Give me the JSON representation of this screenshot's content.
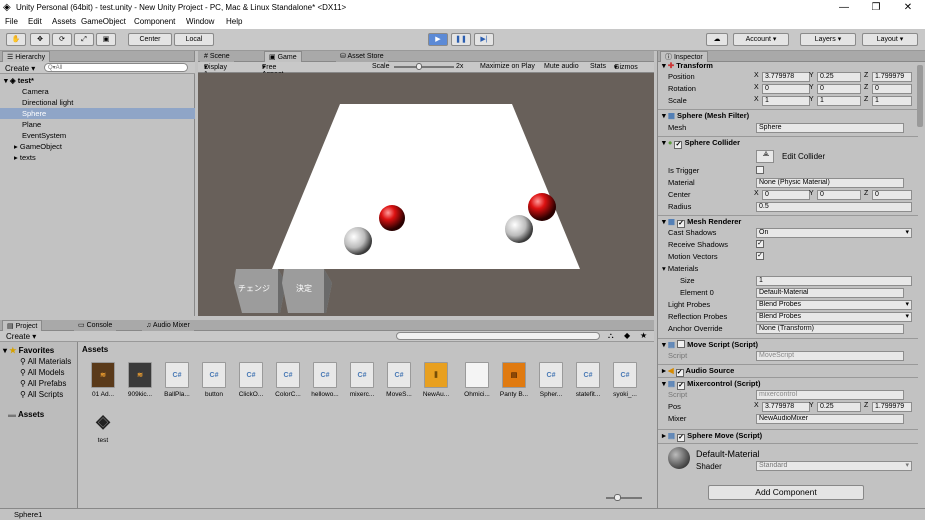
{
  "window": {
    "title": "Unity Personal (64bit) - test.unity - New Unity Project - PC, Mac & Linux Standalone* <DX11>",
    "minimize": "—",
    "maximize": "❐",
    "close": "✕"
  },
  "menu": [
    "File",
    "Edit",
    "Assets",
    "GameObject",
    "Component",
    "Window",
    "Help"
  ],
  "toolbar": {
    "center": "Center",
    "local": "Local",
    "account": "Account",
    "layers": "Layers",
    "layout": "Layout"
  },
  "hierarchy": {
    "tab": "Hierarchy",
    "create": "Create",
    "search_placeholder": "Q▾All",
    "scene": "test*",
    "items": [
      "Camera",
      "Directional light",
      "Sphere",
      "Plane",
      "EventSystem",
      "GameObject",
      "texts"
    ]
  },
  "game": {
    "tabs": [
      "Scene",
      "Game",
      "Asset Store"
    ],
    "display": "Display 1",
    "aspect": "Free Aspect",
    "scale_label": "Scale",
    "scale_value": "2x",
    "options": [
      "Maximize on Play",
      "Mute audio",
      "Stats",
      "Gizmos"
    ],
    "buttons": [
      "チェンジ",
      "決定"
    ]
  },
  "project": {
    "tabs": [
      "Project",
      "Console",
      "Audio Mixer"
    ],
    "create": "Create",
    "favorites": "Favorites",
    "fav_items": [
      "All Materials",
      "All Models",
      "All Prefabs",
      "All Scripts"
    ],
    "assets_root": "Assets",
    "breadcrumb": "Assets",
    "assets": [
      "01 Ad...",
      "909kic...",
      "BallPla...",
      "button",
      "ClickO...",
      "ColorC...",
      "hellowo...",
      "mixerc...",
      "MoveS...",
      "NewAu...",
      "Ohmici...",
      "Panty B...",
      "Spher...",
      "statefit...",
      "syoki_...",
      "test"
    ]
  },
  "inspector": {
    "tab": "Inspector",
    "transform": {
      "title": "Transform",
      "position": {
        "label": "Position",
        "x": "3.779978",
        "y": "0.25",
        "z": "1.799979"
      },
      "rotation": {
        "label": "Rotation",
        "x": "0",
        "y": "0",
        "z": "0"
      },
      "scale": {
        "label": "Scale",
        "x": "1",
        "y": "1",
        "z": "1"
      }
    },
    "mesh_filter": {
      "title": "Sphere (Mesh Filter)",
      "mesh_label": "Mesh",
      "mesh": "Sphere"
    },
    "collider": {
      "title": "Sphere Collider",
      "edit": "Edit Collider",
      "is_trigger": "Is Trigger",
      "material_label": "Material",
      "material": "None (Physic Material)",
      "center_label": "Center",
      "cx": "0",
      "cy": "0",
      "cz": "0",
      "radius_label": "Radius",
      "radius": "0.5"
    },
    "renderer": {
      "title": "Mesh Renderer",
      "cast_label": "Cast Shadows",
      "cast": "On",
      "receive": "Receive Shadows",
      "motion": "Motion Vectors",
      "materials": "Materials",
      "size_label": "Size",
      "size": "1",
      "element_label": "Element 0",
      "element": "Default-Material",
      "light_label": "Light Probes",
      "light": "Blend Probes",
      "refl_label": "Reflection Probes",
      "refl": "Blend Probes",
      "anchor_label": "Anchor Override",
      "anchor": "None (Transform)"
    },
    "move_script": {
      "title": "Move Script (Script)",
      "script_label": "Script",
      "script": "MoveScript"
    },
    "audio": {
      "title": "Audio Source"
    },
    "mixer": {
      "title": "Mixercontrol (Script)",
      "script_label": "Script",
      "script": "mixercontrol",
      "pos_label": "Pos",
      "x": "3.779978",
      "y": "0.25",
      "z": "1.799979",
      "mixer_label": "Mixer",
      "mixer": "NewAudioMixer"
    },
    "sphere_move": {
      "title": "Sphere Move (Script)"
    },
    "material": {
      "name": "Default-Material",
      "shader_label": "Shader",
      "shader": "Standard"
    },
    "add_component": "Add Component"
  },
  "axes": {
    "x": "X",
    "y": "Y",
    "z": "Z"
  },
  "status": "Sphere1"
}
